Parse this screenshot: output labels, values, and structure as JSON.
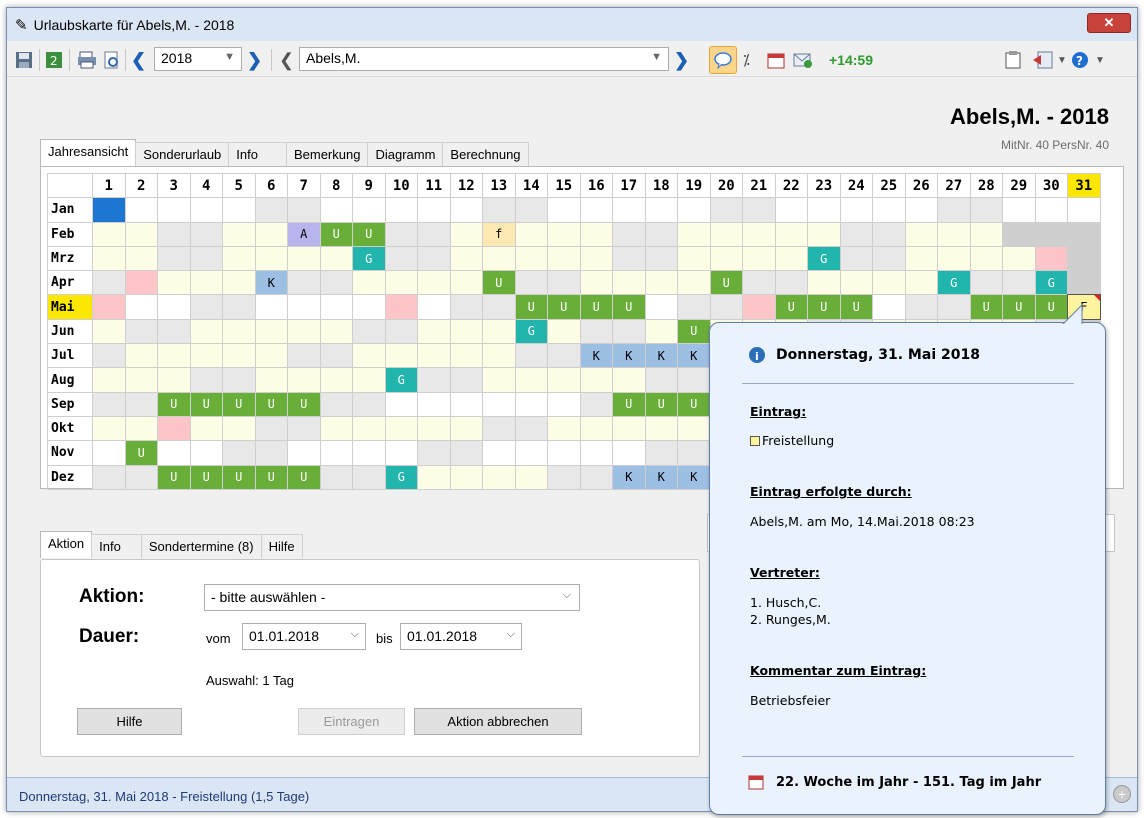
{
  "window": {
    "title": "Urlaubskarte für Abels,M. - 2018",
    "close_label": "✕"
  },
  "toolbar": {
    "year": "2018",
    "employee": "Abels,M.",
    "time_balance": "+14:59"
  },
  "header": {
    "name_year": "Abels,M. - 2018",
    "ids": "MitNr. 40   PersNr. 40"
  },
  "top_tabs": [
    "Jahresansicht",
    "Sonderurlaub",
    "Info",
    "Bemerkung",
    "Diagramm",
    "Berechnung"
  ],
  "calendar": {
    "days": [
      "1",
      "2",
      "3",
      "4",
      "5",
      "6",
      "7",
      "8",
      "9",
      "10",
      "11",
      "12",
      "13",
      "14",
      "15",
      "16",
      "17",
      "18",
      "19",
      "20",
      "21",
      "22",
      "23",
      "24",
      "25",
      "26",
      "27",
      "28",
      "29",
      "30",
      "31"
    ],
    "months": [
      "Jan",
      "Feb",
      "Mrz",
      "Apr",
      "Mai",
      "Jun",
      "Jul",
      "Aug",
      "Sep",
      "Okt",
      "Nov",
      "Dez"
    ],
    "highlight_month": "Mai",
    "highlight_day": "31",
    "rows": [
      [
        "bl",
        "",
        "",
        "",
        "",
        "w",
        "w",
        "",
        "",
        "",
        "",
        "",
        "w",
        "w",
        "",
        "",
        "",
        "",
        "",
        "w",
        "w",
        "",
        "",
        "",
        "",
        "",
        "w",
        "w",
        "",
        "",
        ""
      ],
      [
        "y",
        "y",
        "w",
        "w",
        "y",
        "y",
        "A",
        "U",
        "U",
        "w",
        "w",
        "y",
        "f",
        "y",
        "y",
        "y",
        "w",
        "w",
        "y",
        "y",
        "y",
        "y",
        "y",
        "w",
        "w",
        "y",
        "y",
        "y",
        "g",
        "g",
        "g"
      ],
      [
        "y",
        "y",
        "w",
        "w",
        "y",
        "y",
        "y",
        "y",
        "G",
        "w",
        "w",
        "y",
        "y",
        "y",
        "y",
        "y",
        "w",
        "w",
        "y",
        "y",
        "y",
        "y",
        "G",
        "w",
        "w",
        "y",
        "y",
        "y",
        "y",
        "p",
        "g"
      ],
      [
        "w",
        "p",
        "y",
        "y",
        "y",
        "K",
        "w",
        "w",
        "y",
        "y",
        "y",
        "y",
        "U",
        "w",
        "w",
        "y",
        "y",
        "y",
        "y",
        "U",
        "w",
        "w",
        "y",
        "y",
        "y",
        "y",
        "G",
        "w",
        "w",
        "G",
        "g"
      ],
      [
        "p",
        "",
        "",
        "w",
        "w",
        "",
        "",
        "",
        "",
        "p",
        "",
        "w",
        "w",
        "U",
        "U",
        "U",
        "U",
        "",
        "w",
        "w",
        "p",
        "U",
        "U",
        "U",
        "",
        "w",
        "w",
        "U",
        "U",
        "U",
        "F"
      ],
      [
        "y",
        "w",
        "w",
        "y",
        "y",
        "y",
        "y",
        "y",
        "w",
        "w",
        "y",
        "y",
        "y",
        "G",
        "y",
        "w",
        "w",
        "y",
        "U",
        "y",
        "y",
        "y",
        "w",
        "w",
        "y",
        "y",
        "y",
        "y",
        "y",
        "w",
        "g"
      ],
      [
        "w",
        "y",
        "y",
        "y",
        "y",
        "y",
        "w",
        "w",
        "y",
        "y",
        "y",
        "y",
        "y",
        "w",
        "w",
        "K",
        "K",
        "K",
        "K",
        "y",
        "w",
        "w",
        "y",
        "y",
        "y",
        "y",
        "y",
        "w",
        "w",
        "y",
        "y"
      ],
      [
        "y",
        "y",
        "y",
        "w",
        "w",
        "y",
        "y",
        "y",
        "y",
        "G",
        "w",
        "w",
        "y",
        "y",
        "y",
        "y",
        "y",
        "w",
        "w",
        "y",
        "y",
        "y",
        "y",
        "y",
        "w",
        "w",
        "y",
        "y",
        "y",
        "y",
        "y"
      ],
      [
        "w",
        "w",
        "U",
        "U",
        "U",
        "U",
        "U",
        "w",
        "w",
        "",
        "",
        "",
        "",
        "",
        "",
        "w",
        "U",
        "U",
        "U",
        "y",
        "y",
        "y",
        "w",
        "w",
        "y",
        "y",
        "y",
        "y",
        "y",
        "w",
        "g"
      ],
      [
        "y",
        "y",
        "p",
        "y",
        "y",
        "w",
        "w",
        "y",
        "y",
        "y",
        "y",
        "y",
        "w",
        "w",
        "y",
        "y",
        "y",
        "y",
        "y",
        "w",
        "w",
        "y",
        "y",
        "y",
        "y",
        "y",
        "w",
        "w",
        "y",
        "y",
        "y"
      ],
      [
        "",
        "U",
        "",
        "",
        "w",
        "w",
        "",
        "",
        "",
        "",
        "w",
        "w",
        "",
        "",
        "",
        "",
        "",
        "w",
        "w",
        "",
        "",
        "",
        "",
        "",
        "w",
        "w",
        "",
        "",
        "",
        "",
        "g"
      ],
      [
        "w",
        "w",
        "U",
        "U",
        "U",
        "U",
        "U",
        "w",
        "w",
        "G",
        "y",
        "y",
        "y",
        "y",
        "w",
        "w",
        "K",
        "K",
        "K",
        "y",
        "y",
        "w",
        "w",
        "y",
        "y",
        "y",
        "y",
        "y",
        "w",
        "w",
        "y"
      ]
    ]
  },
  "bottom_tabs": [
    "Aktion",
    "Info",
    "Sondertermine (8)",
    "Hilfe"
  ],
  "action": {
    "aktion_label": "Aktion:",
    "aktion_value": "- bitte auswählen -",
    "dauer_label": "Dauer:",
    "vom_label": "vom",
    "vom_value": "01.01.2018",
    "bis_label": "bis",
    "bis_value": "01.01.2018",
    "auswahl": "Auswahl:  1 Tag",
    "btn_hilfe": "Hilfe",
    "btn_eintragen": "Eintragen",
    "btn_abbrechen": "Aktion abbrechen"
  },
  "status": {
    "text": "Donnerstag, 31. Mai 2018  -  Freistellung (1,5 Tage)"
  },
  "popup": {
    "date": "Donnerstag, 31. Mai 2018",
    "entry_label": "Eintrag:",
    "entry_value": "Freistellung",
    "by_label": "Eintrag erfolgte durch:",
    "by_value": "Abels,M. am Mo, 14.Mai.2018 08:23",
    "deputy_label": "Vertreter:",
    "deputy_1": "1. Husch,C.",
    "deputy_2": "2. Runges,M.",
    "comment_label": "Kommentar zum Eintrag:",
    "comment_value": "Betriebsfeier",
    "footer": "22. Woche im Jahr - 151. Tag im Jahr"
  },
  "colors": {
    "vacation_U": "#6aae3a",
    "G": "#21b5ae",
    "K": "#9dbfe4",
    "A": "#b8b4ec",
    "highlight": "#fce700",
    "weekend": "#e8e8e8",
    "workday": "#fefde6"
  }
}
